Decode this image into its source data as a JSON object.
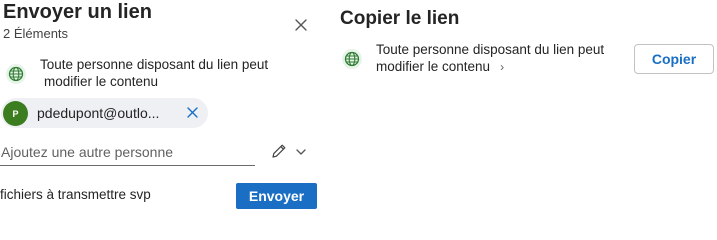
{
  "send_panel": {
    "title": "Envoyer un lien",
    "item_count": "2 Éléments",
    "permission": {
      "line1": "Toute personne disposant du lien peut",
      "line2": "modifier le contenu"
    },
    "recipient": {
      "initial": "P",
      "email": "pdedupont@outlo..."
    },
    "add_person_placeholder": "Ajoutez une autre personne",
    "message_value": "fichiers à transmettre svp",
    "send_label": "Envoyer"
  },
  "copy_panel": {
    "title": "Copier le lien",
    "permission": {
      "line1": "Toute personne disposant du lien peut",
      "line2": "modifier le contenu"
    },
    "copy_label": "Copier"
  },
  "colors": {
    "primary": "#1a6fc4",
    "avatar": "#3c7d20",
    "globe_green": "#2e7d32",
    "chip_bg": "#eef0f3"
  },
  "icons": [
    "close-icon",
    "globe-icon",
    "remove-recipient-icon",
    "pencil-icon",
    "chevron-down-icon",
    "chevron-right-icon"
  ]
}
